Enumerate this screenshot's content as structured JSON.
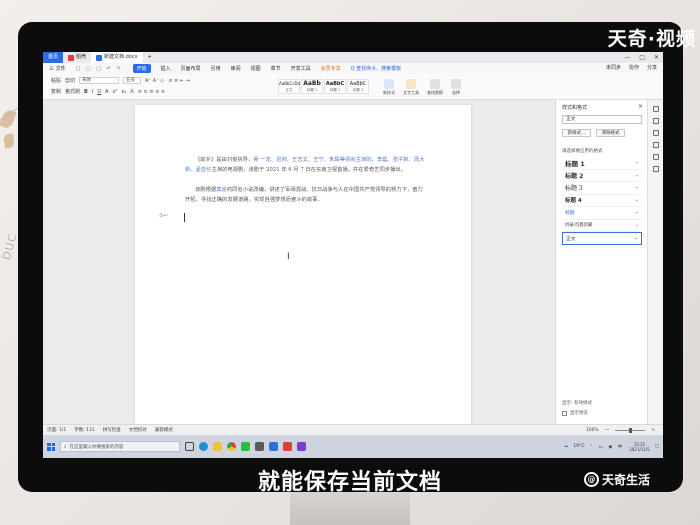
{
  "watermark": {
    "brand_top": "天奇·视频",
    "subtitle": "就能保存当前文档",
    "brand_bottom": "天奇生活",
    "brand_bottom_icon": "@",
    "decor_text": "DUC"
  },
  "app": {
    "tabs": {
      "home": "首页",
      "wps": "稻壳",
      "doc": "新建文档.docx"
    },
    "window_controls": [
      "—",
      "□",
      "✕"
    ],
    "new_tab": "+"
  },
  "menu": {
    "file": "三 文件",
    "items": [
      "开始",
      "插入",
      "页面布局",
      "引用",
      "审阅",
      "视图",
      "章节",
      "开发工具",
      "会员专享",
      "Q 查找命令、搜索模板"
    ],
    "active_index": 0,
    "right": [
      "未同步",
      "协作",
      "分享"
    ]
  },
  "ribbon": {
    "paste": "粘贴",
    "cut": "剪切",
    "copy": "复制",
    "format_painter": "格式刷",
    "font": "宋体",
    "size": "五号",
    "styles": [
      {
        "sample": "AaBbCcDd",
        "label": "正文"
      },
      {
        "sample": "AaBb",
        "label": "标题 1"
      },
      {
        "sample": "AaBbC",
        "label": "标题 2"
      },
      {
        "sample": "AaBbC",
        "label": "标题 3"
      }
    ],
    "tools": [
      "新样式",
      "文字工具",
      "查找替换",
      "选择"
    ]
  },
  "document": {
    "para1": {
      "p1": "《故乡》是由刘俊执导，",
      "h1": "吴 一龙、迟帅、王志文、王宁、朱珠等领衔主演的",
      "p2": "，",
      "h2": "李晨、张子默、周大新、孟亚伦",
      "p3": "主演的电视剧。该剧于 2021 年 6 月 7 日在东南卫视首播，并在爱奇艺同步播出。"
    },
    "para2": {
      "p1": "该剧根据",
      "h1": "莫言",
      "p2": "的同名小说改编，讲述了军阀混战、抗日战争与人在中国共产党领导的努力下，奋力开拓、寻找正确的发展道路，实现自强梦想而奋斗的故事",
      "h2": "。"
    },
    "side_mark": "①↩",
    "ibeam": "I"
  },
  "style_pane": {
    "title": "样式和格式",
    "close": "✕",
    "current": "正文",
    "new_style_btn": "新样式...",
    "clear_btn": "清除格式",
    "section": "请选择要应用的格式",
    "styles": [
      "标题 1",
      "标题 2",
      "标题 3",
      "标题 4",
      "标题",
      "目录/页眉页脚",
      "正文"
    ],
    "selected_index": 6,
    "mark": "↵",
    "show": "显示: 有效样式",
    "preview": "显示预览"
  },
  "statusbar": {
    "page": "页面: 1/1",
    "words": "字数: 131",
    "spell": "拼写检查",
    "proofread": "文档校对",
    "compat": "兼容模式",
    "zoom": "100%",
    "minus": "—",
    "plus": "+"
  },
  "taskbar": {
    "search_placeholder": "在这里输入你要搜索的内容",
    "weather": "19°C",
    "time": "15:21",
    "date": "2021/11/5"
  },
  "colors": {
    "accent": "#2d6ae8",
    "link_text": "#4f78c9",
    "monitor": "#0c0c0c"
  }
}
